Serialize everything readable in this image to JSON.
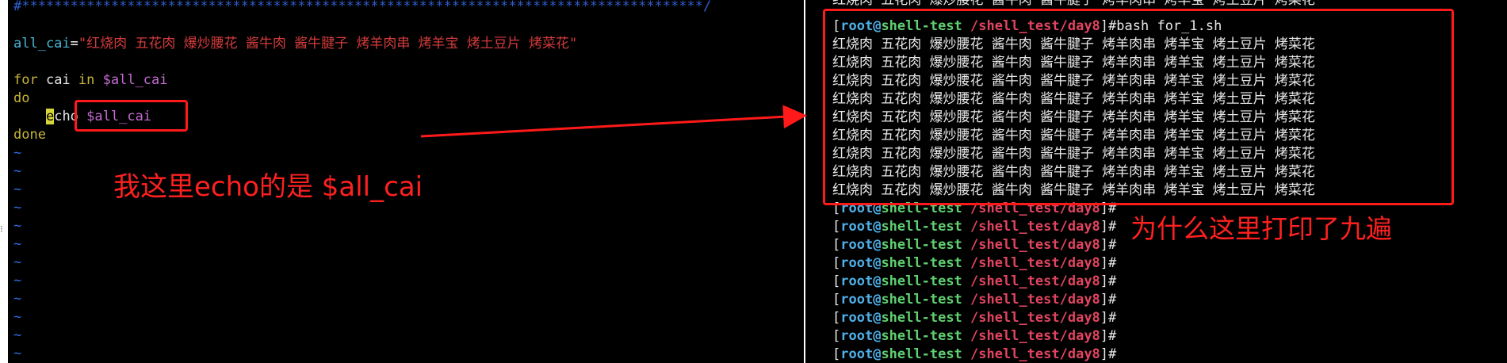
{
  "vim": {
    "comment_line": "#************************************************************************************/",
    "assign_var": "all_cai",
    "assign_eq": "=",
    "assign_value": "\"红烧肉 五花肉 爆炒腰花 酱牛肉 酱牛腱子 烤羊肉串 烤羊宝 烤土豆片 烤菜花\"",
    "for_kw": "for",
    "for_var": " cai ",
    "in_kw": "in",
    "for_list": " $all_cai",
    "do_kw": "do",
    "echo_indent": "    ",
    "echo_cursor": "e",
    "echo_rest": "cho ",
    "echo_arg": "$all_cai",
    "done_kw": "done",
    "tilde": "~"
  },
  "annotations": {
    "left_note": "我这里echo的是 $all_cai",
    "right_note": "为什么这里打印了九遍"
  },
  "terminal": {
    "top_partial": "红烧肉 五花肉 爆炒腰花 酱牛肉 酱牛腱子 烤羊肉串 烤羊宝 烤土豆片 烤菜花",
    "prompt_open": "[",
    "prompt_user": "root@",
    "prompt_host": "shell-test",
    "prompt_path": " /shell_test/day8",
    "prompt_close": "]#",
    "command": "bash for_1.sh",
    "output_line": "红烧肉 五花肉 爆炒腰花 酱牛肉 酱牛腱子 烤羊肉串 烤羊宝 烤土豆片 烤菜花",
    "output_count": 9,
    "empty_prompt_count": 9
  },
  "colors": {
    "annotation_red": "#ff1a1a",
    "vim_bg": "#000000",
    "terminal_bg": "#000000"
  }
}
